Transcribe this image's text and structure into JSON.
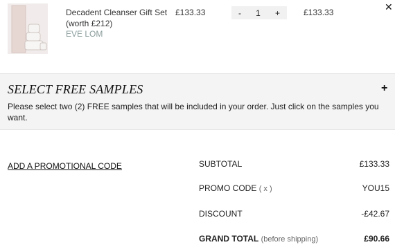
{
  "item": {
    "name": "Decadent Cleanser Gift Set (worth £212)",
    "brand": "EVE LOM",
    "price": "£133.33",
    "quantity": "1",
    "qty_minus": "-",
    "qty_plus": "+",
    "total": "£133.33",
    "remove": "✕"
  },
  "samples": {
    "title": "SELECT FREE SAMPLES",
    "expand": "+",
    "description": "Please select two (2) FREE samples that will be included in your order. Just click on the samples you want."
  },
  "promo_link": "ADD A PROMOTIONAL CODE",
  "totals": {
    "subtotal_label": "SUBTOTAL",
    "subtotal_value": "£133.33",
    "promo_label": "PROMO CODE",
    "promo_remove": "( x )",
    "promo_value": "YOU15",
    "discount_label": "DISCOUNT",
    "discount_value": "-£42.67",
    "grand_label": "GRAND TOTAL",
    "grand_note": "(before shipping)",
    "grand_value": "£90.66"
  }
}
